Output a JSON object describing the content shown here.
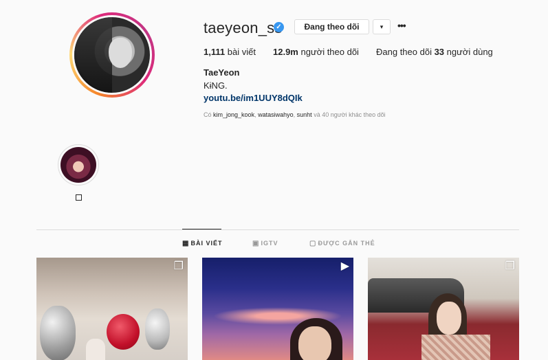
{
  "profile": {
    "username": "taeyeon_ss",
    "follow_button": "Đang theo dõi",
    "dropdown_icon": "▾",
    "more_icon": "•••",
    "verified_icon": "✓",
    "stats": {
      "posts_count": "1,111",
      "posts_label": "bài viết",
      "followers_count": "12.9m",
      "followers_label": "người theo dõi",
      "following_prefix": "Đang theo dõi",
      "following_count": "33",
      "following_label": "người dùng"
    },
    "full_name": "TaeYeon",
    "bio": "KɨNG.",
    "link": "youtu.be/im1UUY8dQIk",
    "followed_by": {
      "prefix": "Có",
      "name1": "kim_jong_kook",
      "name2": "watasiwahyo",
      "name3": "sunht",
      "suffix": "và 40 người khác theo dõi"
    }
  },
  "highlights": [
    {
      "label": "□"
    }
  ],
  "tabs": [
    {
      "icon": "▦",
      "label": "BÀI VIẾT",
      "active": true
    },
    {
      "icon": "▣",
      "label": "IGTV",
      "active": false
    },
    {
      "icon": "▢",
      "label": "ĐƯỢC GẮN THẺ",
      "active": false
    }
  ],
  "posts": [
    {
      "badge": "❐"
    },
    {
      "badge": "▶"
    },
    {
      "badge": "❐"
    }
  ],
  "colors": {
    "accent": "#3897f0",
    "link": "#003569",
    "text": "#262626",
    "muted": "#8e8e8e",
    "border": "#dbdbdb",
    "background": "#fafafa"
  }
}
